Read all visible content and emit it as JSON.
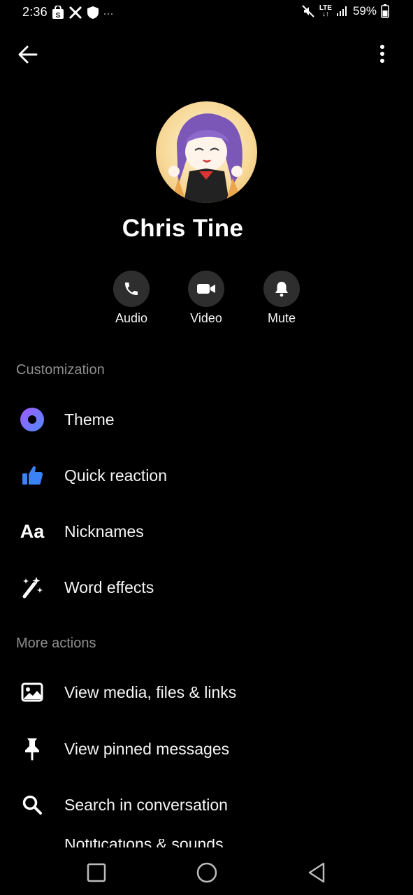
{
  "status_bar": {
    "time": "2:36",
    "battery": "59%",
    "network": "LTE",
    "icons": [
      "shopping-bag-icon",
      "x-logo-icon",
      "shield-icon",
      "more-notifications-icon",
      "mute-icon",
      "signal-icon",
      "battery-icon"
    ]
  },
  "header": {
    "back_icon": "arrow-left-icon",
    "more_icon": "vertical-dots-icon"
  },
  "profile": {
    "name": "Chris Tine"
  },
  "quick_actions": [
    {
      "label": "Audio",
      "icon": "phone-icon"
    },
    {
      "label": "Video",
      "icon": "video-camera-icon"
    },
    {
      "label": "Mute",
      "icon": "bell-icon"
    }
  ],
  "customization": {
    "title": "Customization",
    "items": [
      {
        "label": "Theme",
        "icon": "theme-icon"
      },
      {
        "label": "Quick reaction",
        "icon": "thumbs-up-icon"
      },
      {
        "label": "Nicknames",
        "icon": "text-aa-icon",
        "icon_text": "Aa"
      },
      {
        "label": "Word effects",
        "icon": "magic-wand-icon"
      }
    ]
  },
  "more_actions": {
    "title": "More actions",
    "items": [
      {
        "label": "View media, files & links",
        "icon": "image-icon"
      },
      {
        "label": "View pinned messages",
        "icon": "pin-icon"
      },
      {
        "label": "Search in conversation",
        "icon": "search-icon"
      }
    ],
    "partial_item": "Notifications & sounds"
  },
  "colors": {
    "background": "#000000",
    "button_circle": "#2e2e2e",
    "section_title": "#8e8e8e",
    "theme_gradient_start": "#a259ff",
    "theme_gradient_end": "#4f8bff",
    "like_blue": "#3b82f6"
  }
}
